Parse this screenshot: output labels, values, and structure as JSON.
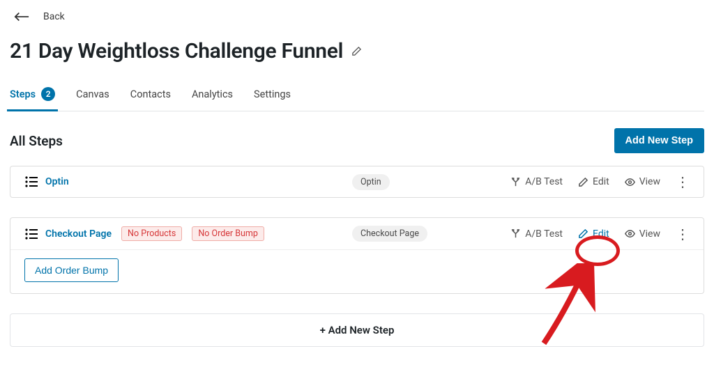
{
  "back": {
    "label": "Back"
  },
  "page": {
    "title": "21 Day Weightloss Challenge Funnel"
  },
  "tabs": {
    "steps": {
      "label": "Steps",
      "count": "2"
    },
    "canvas": {
      "label": "Canvas"
    },
    "contacts": {
      "label": "Contacts"
    },
    "analytics": {
      "label": "Analytics"
    },
    "settings": {
      "label": "Settings"
    }
  },
  "section": {
    "title": "All Steps",
    "add_btn": "Add New Step"
  },
  "actions": {
    "abtest": "A/B Test",
    "edit": "Edit",
    "view": "View"
  },
  "steps": {
    "0": {
      "name": "Optin",
      "type_pill": "Optin"
    },
    "1": {
      "name": "Checkout Page",
      "type_pill": "Checkout Page",
      "warn1": "No Products",
      "warn2": "No Order Bump",
      "order_bump_btn": "Add Order Bump"
    }
  },
  "footer": {
    "add_step": "+  Add New Step"
  }
}
